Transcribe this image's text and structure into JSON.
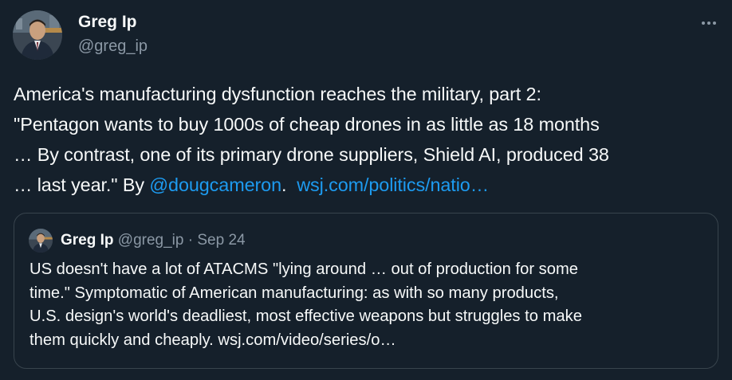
{
  "author": {
    "name": "Greg Ip",
    "handle": "@greg_ip"
  },
  "more_icon": "ellipsis-icon",
  "tweet": {
    "lines": [
      "America's manufacturing dysfunction reaches the military, part 2:",
      "\"Pentagon wants to buy 1000s of cheap drones in as little as 18 months",
      "… By contrast, one of its primary drone suppliers, Shield AI, produced 38"
    ],
    "last_line_prefix": "… last year.\" By ",
    "mention": "@dougcameron",
    "after_mention": ".",
    "link": "wsj.com/politics/natio…"
  },
  "quoted_tweet": {
    "name": "Greg Ip",
    "handle": "@greg_ip",
    "separator": "·",
    "date": "Sep 24",
    "lines": [
      "US doesn't have a lot of ATACMS \"lying around … out of production for some",
      "time.\" Symptomatic of American manufacturing: as with so many products,",
      "U.S. design's world's deadliest, most effective weapons but struggles to make",
      "them quickly and cheaply. wsj.com/video/series/o…"
    ]
  },
  "colors": {
    "background": "#15202b",
    "text": "#f7f9f9",
    "secondary": "#8b98a5",
    "link": "#1d9bf0",
    "border": "#38444d"
  }
}
